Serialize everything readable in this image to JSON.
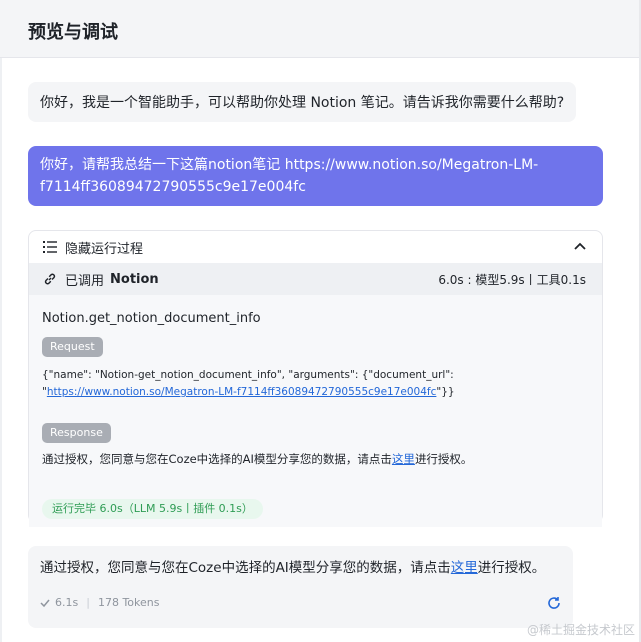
{
  "header": {
    "title": "预览与调试"
  },
  "bot_greeting": "你好，我是一个智能助手，可以帮助你处理 Notion 笔记。请告诉我你需要什么帮助?",
  "user_message": {
    "line1": "你好，请帮我总结一下这篇notion笔记 https://www.notion.so/Megatron-LM-",
    "line2": "f7114ff36089472790555c9e17e004fc"
  },
  "run_panel": {
    "toggle_label": "隐藏运行过程",
    "tool_called_prefix": "已调用",
    "tool_name": "Notion",
    "timing": "6.0s : 模型5.9s丨工具0.1s",
    "function_name": "Notion.get_notion_document_info",
    "request_label": "Request",
    "request_json_prefix": "{\"name\": \"Notion-get_notion_document_info\", \"arguments\": {\"document_url\":",
    "request_quote": "\"",
    "request_url": "https://www.notion.so/Megatron-LM-f7114ff36089472790555c9e17e004fc",
    "request_json_suffix": "\"}}",
    "response_label": "Response",
    "response_prefix": "通过授权，您同意与您在Coze中选择的AI模型分享您的数据，请点击",
    "response_link": "这里",
    "response_suffix": "进行授权。",
    "done_badge": "运行完毕 6.0s（LLM 5.9s丨插件 0.1s）"
  },
  "answer": {
    "prefix": "通过授权，您同意与您在Coze中选择的AI模型分享您的数据，请点击",
    "link": "这里",
    "suffix": "进行授权。",
    "time": "6.1s",
    "tokens": "178 Tokens"
  },
  "watermark": "@稀土掘金技术社区",
  "colors": {
    "user_bubble": "#6f74eb",
    "link": "#2468d8",
    "done_green": "#2e9c54"
  }
}
